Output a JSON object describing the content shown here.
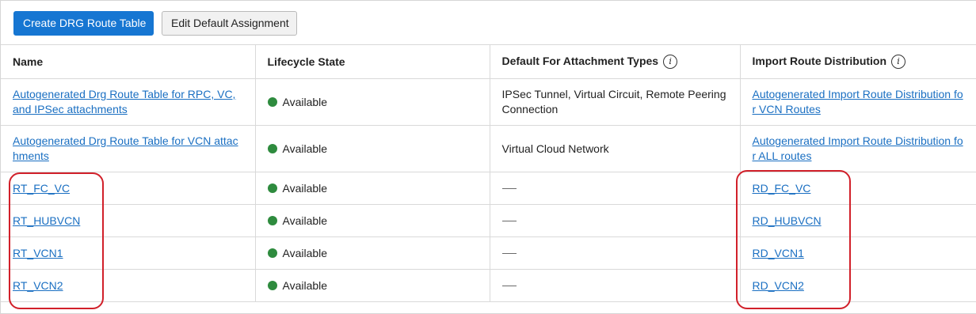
{
  "toolbar": {
    "create_label": "Create DRG Route Table",
    "edit_label": "Edit Default Assignment"
  },
  "table": {
    "headers": {
      "name": "Name",
      "state": "Lifecycle State",
      "default": "Default For Attachment Types",
      "distribution": "Import Route Distribution"
    },
    "rows": [
      {
        "name": "Autogenerated Drg Route Table for RPC, VC, and IPSec attachments",
        "state": "Available",
        "default": "IPSec Tunnel, Virtual Circuit, Remote Peering Connection",
        "distribution": "Autogenerated Import Route Distribution for VCN Routes"
      },
      {
        "name": "Autogenerated Drg Route Table for VCN attachments",
        "state": "Available",
        "default": "Virtual Cloud Network",
        "distribution": "Autogenerated Import Route Distribution for ALL routes"
      },
      {
        "name": "RT_FC_VC",
        "state": "Available",
        "default": "",
        "distribution": "RD_FC_VC"
      },
      {
        "name": "RT_HUBVCN",
        "state": "Available",
        "default": "",
        "distribution": "RD_HUBVCN"
      },
      {
        "name": "RT_VCN1",
        "state": "Available",
        "default": "",
        "distribution": "RD_VCN1"
      },
      {
        "name": "RT_VCN2",
        "state": "Available",
        "default": "",
        "distribution": "RD_VCN2"
      }
    ]
  },
  "colors": {
    "primary": "#1676d2",
    "link": "#1a6fc2",
    "status_available": "#2e8b3e",
    "highlight": "#d1202a"
  },
  "icons": {
    "info": "info-icon",
    "status": "status-dot-icon"
  }
}
